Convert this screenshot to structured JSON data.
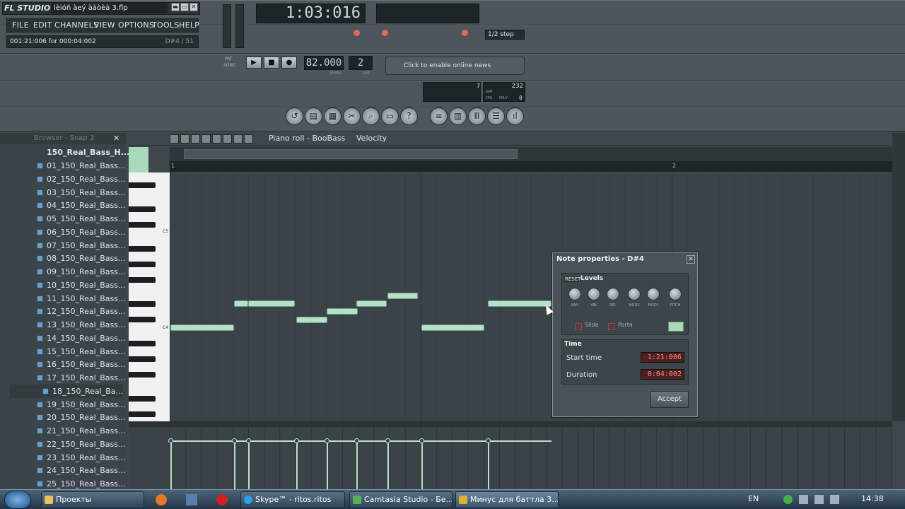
{
  "app": {
    "logo": "FL STUDIO",
    "filename": "lèióñ àeý ààòèà 3.flp",
    "win_buttons": [
      "▬",
      "▭",
      "✕"
    ]
  },
  "menu": [
    "FILE",
    "EDIT",
    "CHANNELS",
    "VIEW",
    "OPTIONS",
    "TOOLS",
    "HELP"
  ],
  "hint": {
    "text": "001:21:006 for 000:04:002",
    "right": "D#4 / 51"
  },
  "time_display": "1:03:016",
  "transport": {
    "tempo": "82.000",
    "pattern": "2",
    "pat_label": "PAT",
    "song_label": "SONG",
    "tempo_label": "TEMPO",
    "pat_num_label": "PAT"
  },
  "step": "1/2 step",
  "news": "Click to enable online news",
  "cpu": {
    "value": "232",
    "ram": "RAM",
    "cpu": "CPU",
    "poly": "POLY",
    "poly_val": "0",
    "v7": "7"
  },
  "browser": {
    "title": "Browser - Snap 3",
    "folder": "150_Real_Bass_H...",
    "items": [
      "01_150_Real_Bass...",
      "02_150_Real_Bass...",
      "03_150_Real_Bass...",
      "04_150_Real_Bass...",
      "05_150_Real_Bass...",
      "06_150_Real_Bass...",
      "07_150_Real_Bass...",
      "08_150_Real_Bass...",
      "09_150_Real_Bass...",
      "10_150_Real_Bass...",
      "11_150_Real_Bass...",
      "12_150_Real_Bass...",
      "13_150_Real_Bass...",
      "14_150_Real_Bass...",
      "15_150_Real_Bass...",
      "16_150_Real_Bass...",
      "17_150_Real_Bass...",
      "18_150_Real_Ba...",
      "19_150_Real_Bass...",
      "20_150_Real_Bass...",
      "21_150_Real_Bass...",
      "22_150_Real_Bass...",
      "23_150_Real_Bass...",
      "24_150_Real_Bass...",
      "25_150_Real_Bass..."
    ]
  },
  "piano_roll": {
    "title": "Piano roll - BooBass",
    "mode": "Velocity",
    "bar1": "1",
    "bar2": "2",
    "c5": "C5",
    "c4": "C4"
  },
  "dialog": {
    "title": "Note properties - D#4",
    "reset": "RESET",
    "levels": "Levels",
    "knobs": [
      "PAN",
      "VEL",
      "REL",
      "MODX",
      "MODY",
      "PITCH"
    ],
    "slide": "Slide",
    "porta": "Porta",
    "time": "Time",
    "start_label": "Start time",
    "start_val": "1:21:006",
    "dur_label": "Duration",
    "dur_val": "0:04:002",
    "accept": "Accept"
  },
  "taskbar": {
    "items": [
      "Проекты",
      "Skype™ - ritos.ritos",
      "Camtasia Studio - Бе...",
      "Минус для баттла 3...."
    ],
    "lang": "EN",
    "clock": "14:38"
  }
}
